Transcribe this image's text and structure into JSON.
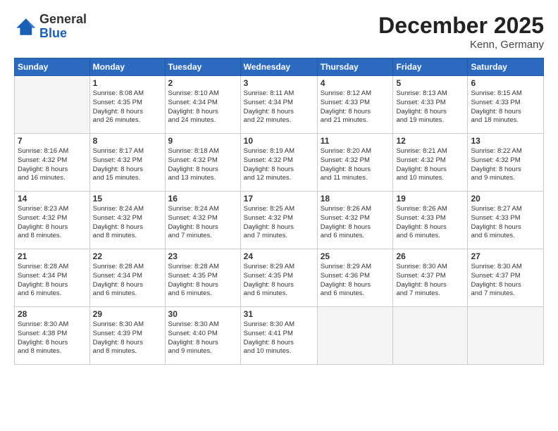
{
  "logo": {
    "general": "General",
    "blue": "Blue"
  },
  "header": {
    "month_year": "December 2025",
    "location": "Kenn, Germany"
  },
  "weekdays": [
    "Sunday",
    "Monday",
    "Tuesday",
    "Wednesday",
    "Thursday",
    "Friday",
    "Saturday"
  ],
  "weeks": [
    [
      {
        "day": "",
        "info": ""
      },
      {
        "day": "1",
        "info": "Sunrise: 8:08 AM\nSunset: 4:35 PM\nDaylight: 8 hours\nand 26 minutes."
      },
      {
        "day": "2",
        "info": "Sunrise: 8:10 AM\nSunset: 4:34 PM\nDaylight: 8 hours\nand 24 minutes."
      },
      {
        "day": "3",
        "info": "Sunrise: 8:11 AM\nSunset: 4:34 PM\nDaylight: 8 hours\nand 22 minutes."
      },
      {
        "day": "4",
        "info": "Sunrise: 8:12 AM\nSunset: 4:33 PM\nDaylight: 8 hours\nand 21 minutes."
      },
      {
        "day": "5",
        "info": "Sunrise: 8:13 AM\nSunset: 4:33 PM\nDaylight: 8 hours\nand 19 minutes."
      },
      {
        "day": "6",
        "info": "Sunrise: 8:15 AM\nSunset: 4:33 PM\nDaylight: 8 hours\nand 18 minutes."
      }
    ],
    [
      {
        "day": "7",
        "info": "Sunrise: 8:16 AM\nSunset: 4:32 PM\nDaylight: 8 hours\nand 16 minutes."
      },
      {
        "day": "8",
        "info": "Sunrise: 8:17 AM\nSunset: 4:32 PM\nDaylight: 8 hours\nand 15 minutes."
      },
      {
        "day": "9",
        "info": "Sunrise: 8:18 AM\nSunset: 4:32 PM\nDaylight: 8 hours\nand 13 minutes."
      },
      {
        "day": "10",
        "info": "Sunrise: 8:19 AM\nSunset: 4:32 PM\nDaylight: 8 hours\nand 12 minutes."
      },
      {
        "day": "11",
        "info": "Sunrise: 8:20 AM\nSunset: 4:32 PM\nDaylight: 8 hours\nand 11 minutes."
      },
      {
        "day": "12",
        "info": "Sunrise: 8:21 AM\nSunset: 4:32 PM\nDaylight: 8 hours\nand 10 minutes."
      },
      {
        "day": "13",
        "info": "Sunrise: 8:22 AM\nSunset: 4:32 PM\nDaylight: 8 hours\nand 9 minutes."
      }
    ],
    [
      {
        "day": "14",
        "info": "Sunrise: 8:23 AM\nSunset: 4:32 PM\nDaylight: 8 hours\nand 8 minutes."
      },
      {
        "day": "15",
        "info": "Sunrise: 8:24 AM\nSunset: 4:32 PM\nDaylight: 8 hours\nand 8 minutes."
      },
      {
        "day": "16",
        "info": "Sunrise: 8:24 AM\nSunset: 4:32 PM\nDaylight: 8 hours\nand 7 minutes."
      },
      {
        "day": "17",
        "info": "Sunrise: 8:25 AM\nSunset: 4:32 PM\nDaylight: 8 hours\nand 7 minutes."
      },
      {
        "day": "18",
        "info": "Sunrise: 8:26 AM\nSunset: 4:32 PM\nDaylight: 8 hours\nand 6 minutes."
      },
      {
        "day": "19",
        "info": "Sunrise: 8:26 AM\nSunset: 4:33 PM\nDaylight: 8 hours\nand 6 minutes."
      },
      {
        "day": "20",
        "info": "Sunrise: 8:27 AM\nSunset: 4:33 PM\nDaylight: 8 hours\nand 6 minutes."
      }
    ],
    [
      {
        "day": "21",
        "info": "Sunrise: 8:28 AM\nSunset: 4:34 PM\nDaylight: 8 hours\nand 6 minutes."
      },
      {
        "day": "22",
        "info": "Sunrise: 8:28 AM\nSunset: 4:34 PM\nDaylight: 8 hours\nand 6 minutes."
      },
      {
        "day": "23",
        "info": "Sunrise: 8:28 AM\nSunset: 4:35 PM\nDaylight: 8 hours\nand 6 minutes."
      },
      {
        "day": "24",
        "info": "Sunrise: 8:29 AM\nSunset: 4:35 PM\nDaylight: 8 hours\nand 6 minutes."
      },
      {
        "day": "25",
        "info": "Sunrise: 8:29 AM\nSunset: 4:36 PM\nDaylight: 8 hours\nand 6 minutes."
      },
      {
        "day": "26",
        "info": "Sunrise: 8:30 AM\nSunset: 4:37 PM\nDaylight: 8 hours\nand 7 minutes."
      },
      {
        "day": "27",
        "info": "Sunrise: 8:30 AM\nSunset: 4:37 PM\nDaylight: 8 hours\nand 7 minutes."
      }
    ],
    [
      {
        "day": "28",
        "info": "Sunrise: 8:30 AM\nSunset: 4:38 PM\nDaylight: 8 hours\nand 8 minutes."
      },
      {
        "day": "29",
        "info": "Sunrise: 8:30 AM\nSunset: 4:39 PM\nDaylight: 8 hours\nand 8 minutes."
      },
      {
        "day": "30",
        "info": "Sunrise: 8:30 AM\nSunset: 4:40 PM\nDaylight: 8 hours\nand 9 minutes."
      },
      {
        "day": "31",
        "info": "Sunrise: 8:30 AM\nSunset: 4:41 PM\nDaylight: 8 hours\nand 10 minutes."
      },
      {
        "day": "",
        "info": ""
      },
      {
        "day": "",
        "info": ""
      },
      {
        "day": "",
        "info": ""
      }
    ]
  ]
}
